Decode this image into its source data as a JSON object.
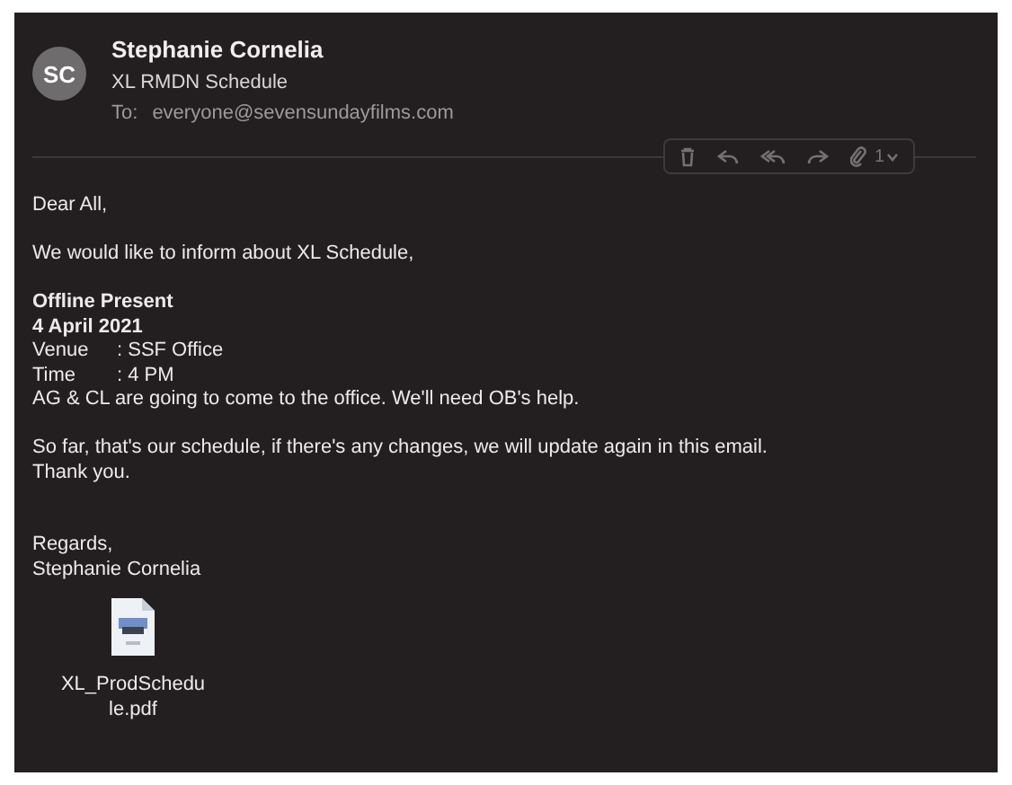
{
  "message": {
    "sender": {
      "initials": "SC",
      "name": "Stephanie Cornelia"
    },
    "subject": "XL RMDN Schedule",
    "to_label": "To:",
    "to": "everyone@sevensundayfilms.com",
    "attachment_count": "1"
  },
  "body": [
    {
      "kind": "text",
      "text": "Dear All,"
    },
    {
      "kind": "gap"
    },
    {
      "kind": "text",
      "text": "We would like to inform about XL Schedule,"
    },
    {
      "kind": "gap"
    },
    {
      "kind": "bold",
      "text": "Offline Present"
    },
    {
      "kind": "bold",
      "text": "4 April 2021"
    },
    {
      "kind": "field",
      "label": "Venue",
      "value": ": SSF Office"
    },
    {
      "kind": "field",
      "label": "Time",
      "value": ": 4 PM"
    },
    {
      "kind": "text",
      "text": "AG & CL are going to come to the office. We'll need OB's help."
    },
    {
      "kind": "gap"
    },
    {
      "kind": "text",
      "text": "So far, that's our schedule, if there's any changes, we will update again in this email."
    },
    {
      "kind": "text",
      "text": "Thank you."
    },
    {
      "kind": "gap"
    },
    {
      "kind": "gap"
    },
    {
      "kind": "text",
      "text": "Regards,"
    },
    {
      "kind": "text",
      "text": "Stephanie Cornelia"
    }
  ],
  "attachment": {
    "filename_lines": [
      "XL_ProdSchedu",
      "le.pdf"
    ]
  }
}
